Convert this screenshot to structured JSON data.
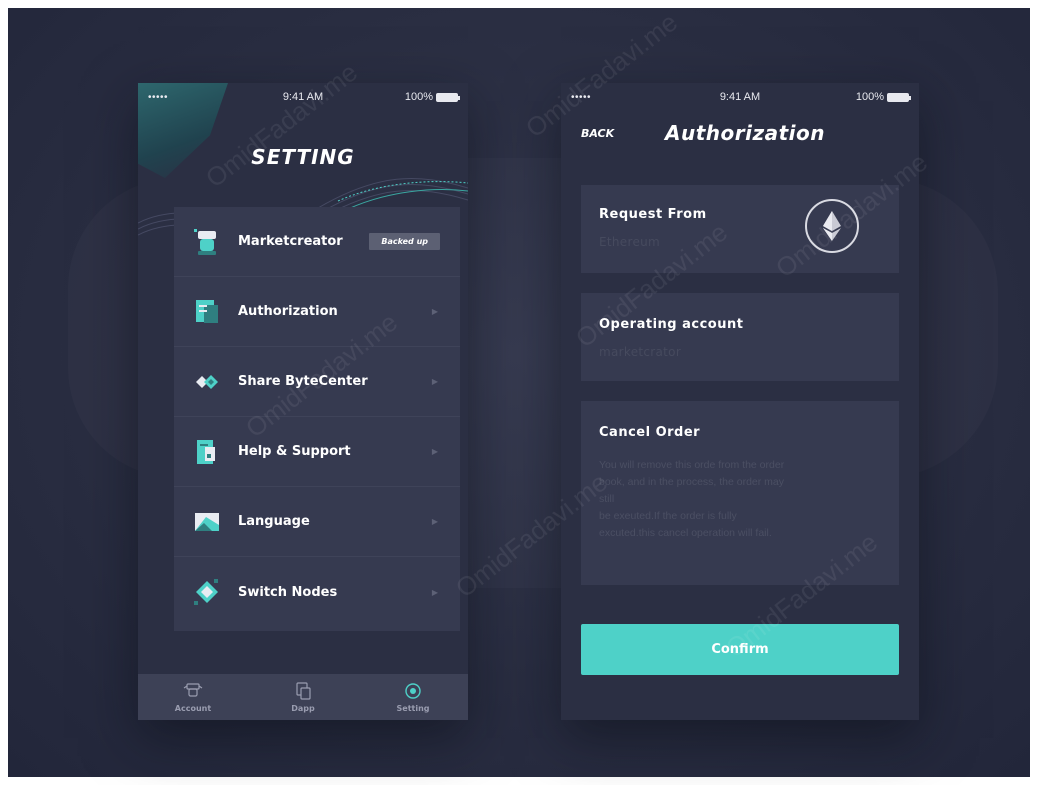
{
  "left_phone": {
    "status": {
      "signal": "•••••",
      "time": "9:41 AM",
      "battery": "100%"
    },
    "title": "SETTING",
    "menu": [
      {
        "label": "Marketcreator",
        "badge": "Backed up",
        "icon": "user-avatar-icon"
      },
      {
        "label": "Authorization",
        "icon": "authorization-icon"
      },
      {
        "label": "Share ByteCenter",
        "icon": "share-icon"
      },
      {
        "label": "Help & Support",
        "icon": "help-icon"
      },
      {
        "label": "Language",
        "icon": "language-icon"
      },
      {
        "label": "Switch Nodes",
        "icon": "switch-nodes-icon"
      }
    ],
    "tabs": [
      {
        "label": "Account",
        "icon": "account-icon"
      },
      {
        "label": "Dapp",
        "icon": "dapp-icon"
      },
      {
        "label": "Setting",
        "icon": "setting-icon",
        "active": true
      }
    ]
  },
  "right_phone": {
    "status": {
      "signal": "•••••",
      "time": "9:41 AM",
      "battery": "100%"
    },
    "back_label": "BACK",
    "title": "Authorization",
    "request_from": {
      "heading": "Request From",
      "value": "Ethereum",
      "icon": "ethereum-icon"
    },
    "operating_account": {
      "heading": "Operating account",
      "value": "marketcrator"
    },
    "cancel_order": {
      "heading": "Cancel Order",
      "text": "You will remove this orde from the order\nbook,  and in the process,  the order may\nstill\nbe exeuted.If the order is fully\nexcuted.this cancel operation will fail."
    },
    "confirm_label": "Confirm"
  },
  "watermark": "OmidFadavi.me",
  "colors": {
    "background": "#2a2e42",
    "phone": "#2b2f43",
    "card": "#363a50",
    "accent": "#4ed1c8",
    "tabbar": "#3d4156"
  }
}
